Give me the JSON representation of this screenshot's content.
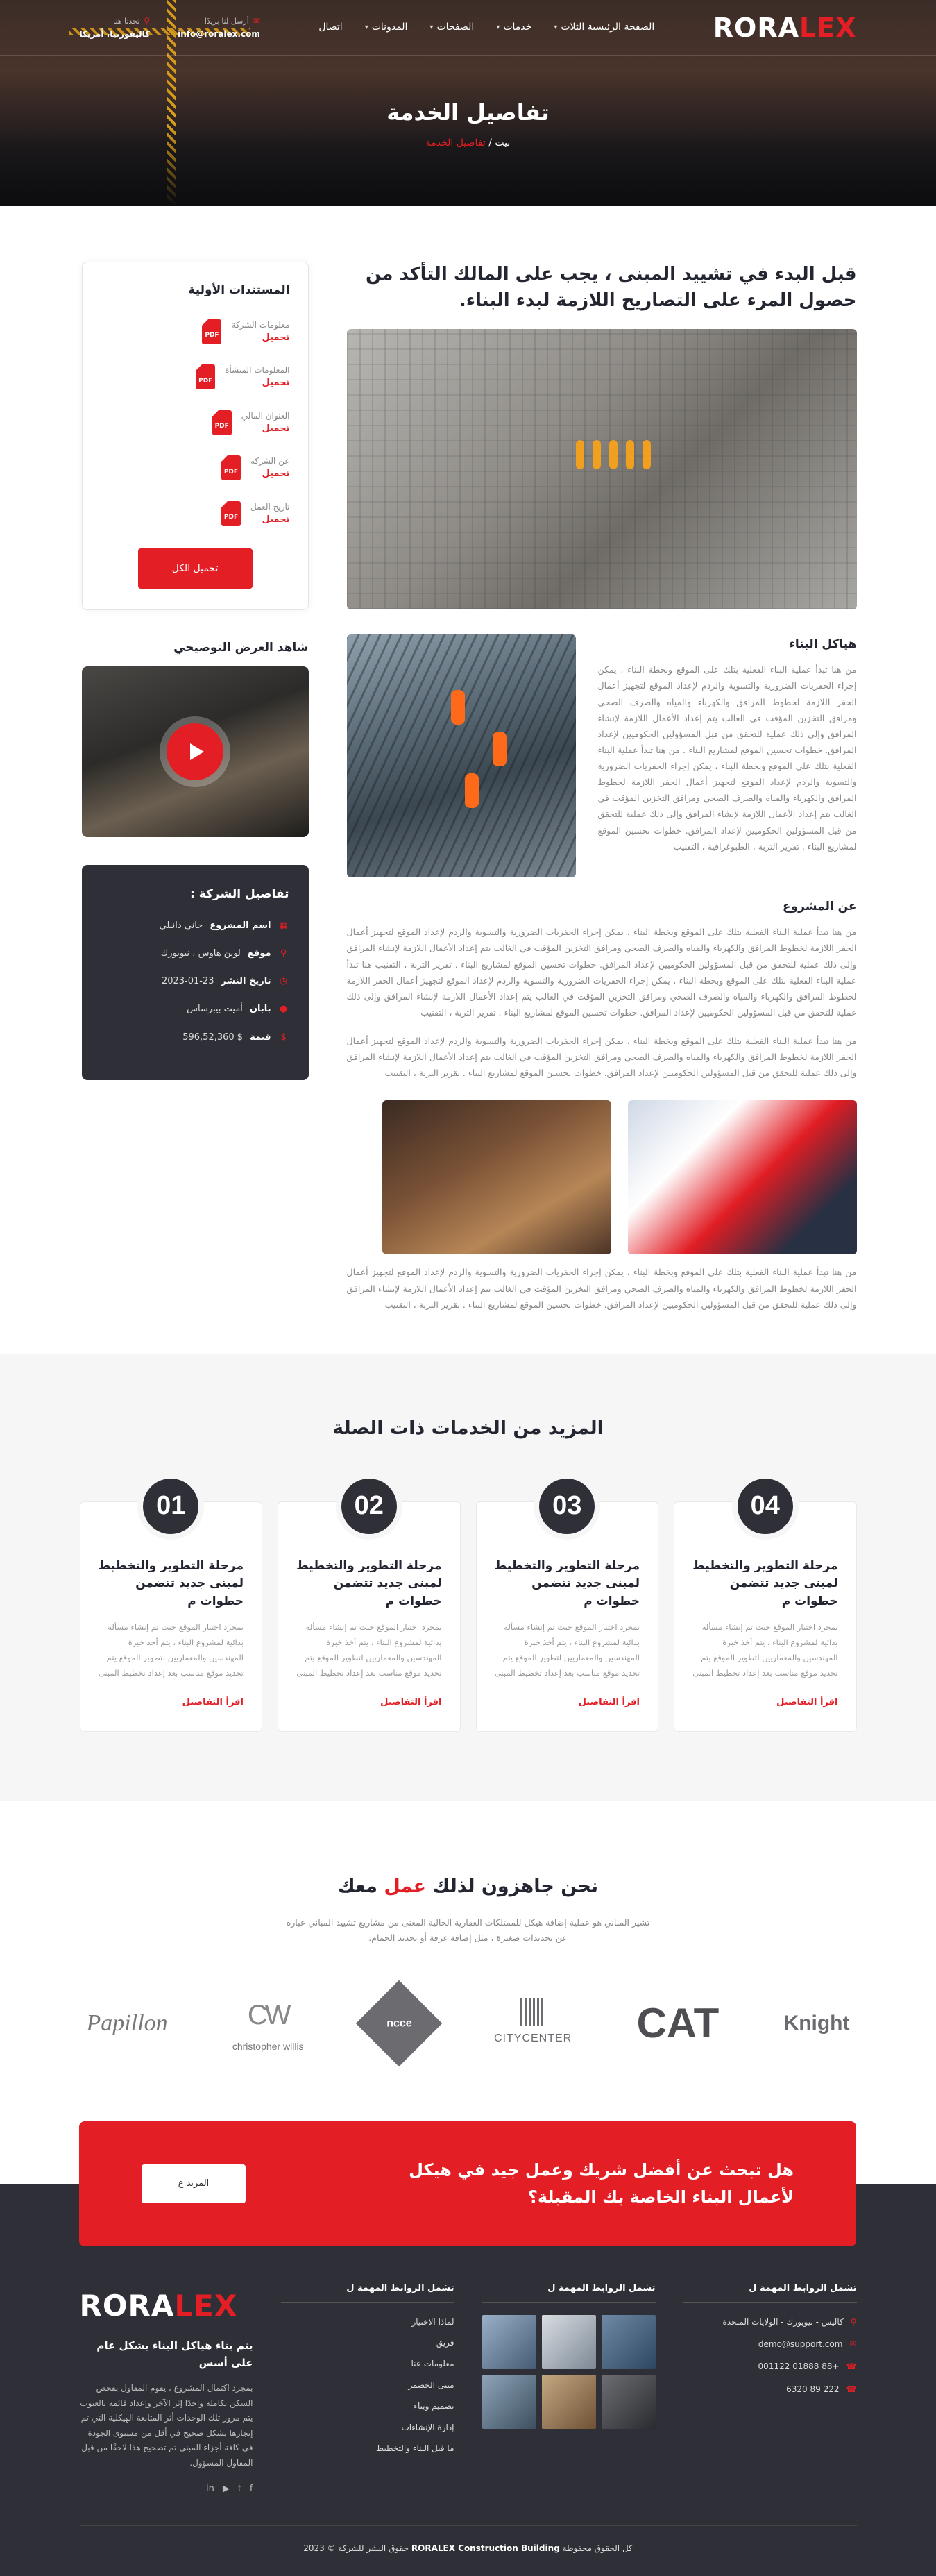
{
  "header": {
    "logo_a": "RORA",
    "logo_b": "LEX",
    "nav": [
      {
        "label": "الصفحة الرئيسية الثلاث",
        "has_chevron": true
      },
      {
        "label": "خدمات",
        "has_chevron": true
      },
      {
        "label": "الصفحات",
        "has_chevron": true
      },
      {
        "label": "المدونات",
        "has_chevron": true
      },
      {
        "label": "اتصال",
        "has_chevron": false
      }
    ],
    "contact_email_label": "أرسل لنا بريدًا",
    "contact_email": "info@roralex.com",
    "contact_location_label": "تجدنا هنا",
    "contact_location": "كاليفورنيا، أمريكا"
  },
  "hero": {
    "title": "تفاصيل الخدمة",
    "breadcrumb_home": "بيت",
    "breadcrumb_sep": " / ",
    "breadcrumb_current": "تفاصيل الخدمة"
  },
  "content": {
    "lead": "قبل البدء في تشييد المبنى ، يجب على المالك التأكد من حصول المرء على التصاريح اللازمة لبدء البناء.",
    "structures_title": "هياكل البناء",
    "structures_text": "من هنا تبدأ عملية البناء الفعلية بتلك على الموقع وبخطة البناء ، يمكن إجراء الحفريات الضرورية والتسوية والردم لإعداد الموقع لتجهيز أعمال الحفر اللازمة لخطوط المرافق والكهرباء والمياه والصرف الصحي ومرافق التخزين المؤقت في الغالب يتم إعداد الأعمال اللازمة لإنشاء المرافق وإلى ذلك عملية للتحقق من قبل المسؤولين الحكوميين لإعداد المرافق. خطوات تحسين الموقع لمشاريع البناء . من هنا تبدأ عملية البناء الفعلية بتلك على الموقع وبخطة البناء ، يمكن إجراء الحفريات الضرورية والتسوية والردم لإعداد الموقع لتجهيز أعمال الحفر اللازمة لخطوط المرافق والكهرباء والمياه والصرف الصحي ومرافق التخزين المؤقت في الغالب يتم إعداد الأعمال اللازمة لإنشاء المرافق وإلى ذلك عملية للتحقق من قبل المسؤولين الحكوميين لإعداد المرافق. خطوات تحسين الموقع لمشاريع البناء . تقرير التربة ، الطبوغرافية ، التقنيب",
    "about_title": "عن المشروع",
    "about_text_1": "من هنا تبدأ عملية البناء الفعلية بتلك على الموقع وبخطة البناء ، يمكن إجراء الحفريات الضرورية والتسوية والردم لإعداد الموقع لتجهيز أعمال الحفر اللازمة لخطوط المرافق والكهرباء والمياه والصرف الصحي ومرافق التخزين المؤقت في الغالب يتم إعداد الأعمال اللازمة لإنشاء المرافق وإلى ذلك عملية للتحقق من قبل المسؤولين الحكوميين لإعداد المرافق. خطوات تحسين الموقع لمشاريع البناء . تقرير التربة ، التقنيب هنا تبدأ عملية البناء الفعلية بتلك على الموقع وبخطة البناء ، يمكن إجراء الحفريات الضرورية والتسوية والردم لإعداد الموقع لتجهيز أعمال الحفر اللازمة لخطوط المرافق والكهرباء والمياه والصرف الصحي ومرافق التخزين المؤقت في الغالب يتم إعداد الأعمال اللازمة لإنشاء المرافق وإلى ذلك عملية للتحقق من قبل المسؤولين الحكوميين لإعداد المرافق. خطوات تحسين الموقع لمشاريع البناء . تقرير التربة ، التقنيب",
    "about_text_2": "من هنا تبدأ عملية البناء الفعلية بتلك على الموقع وبخطة البناء ، يمكن إجراء الحفريات الضرورية والتسوية والردم لإعداد الموقع لتجهيز أعمال الحفر اللازمة لخطوط المرافق والكهرباء والمياه والصرف الصحي ومرافق التخزين المؤقت في الغالب يتم إعداد الأعمال اللازمة لإنشاء المرافق وإلى ذلك عملية للتحقق من قبل المسؤولين الحكوميين لإعداد المرافق. خطوات تحسين الموقع لمشاريع البناء . تقرير التربة ، التقنيب",
    "closing_text": "من هنا تبدأ عملية البناء الفعلية بتلك على الموقع وبخطة البناء ، يمكن إجراء الحفريات الضرورية والتسوية والردم لإعداد الموقع لتجهيز أعمال الحفر اللازمة لخطوط المرافق والكهرباء والمياه والصرف الصحي ومرافق التخزين المؤقت في الغالب يتم إعداد الأعمال اللازمة لإنشاء المرافق وإلى ذلك عملية للتحقق من قبل المسؤولين الحكوميين لإعداد المرافق. خطوات تحسين الموقع لمشاريع البناء . تقرير التربة ، التقنيب"
  },
  "sidebar": {
    "docs_title": "المستندات الأولية",
    "docs": [
      {
        "name": "معلومات الشركة",
        "link": "تحميل"
      },
      {
        "name": "المعلومات المنشأة",
        "link": "تحميل"
      },
      {
        "name": "العنوان المالي",
        "link": "تحميل"
      },
      {
        "name": "عن الشركة",
        "link": "تحميل"
      },
      {
        "name": "تاريخ العمل",
        "link": "تحميل"
      }
    ],
    "pdf_label": "PDF",
    "download_all": "تحميل الكل",
    "video_title": "شاهد العرض التوضيحي",
    "info_title": "تفاصيل الشركة :",
    "info": [
      {
        "icon": "building-icon",
        "key": "اسم المشروع",
        "value": "جاني دانيلي"
      },
      {
        "icon": "location-icon",
        "key": "موقع",
        "value": "لوين هاوس ، نيويورك"
      },
      {
        "icon": "clock-icon",
        "key": "تاريخ النشر",
        "value": "2023-01-23"
      },
      {
        "icon": "user-icon",
        "key": "بابان",
        "value": "أميت بيبرساس"
      },
      {
        "icon": "money-icon",
        "key": "قيمة",
        "value": "$ 596,52,360"
      }
    ]
  },
  "related": {
    "title": "المزيد من الخدمات ذات الصلة",
    "cards": [
      {
        "num": "04",
        "title": "مرحلة التطوير والتخطيط لمبنى جديد تتضمن خطوات م",
        "text": "بمجرد اختيار الموقع حيث تم إنشاء مسألة بدائية لمشروع البناء ، يتم أخذ خبرة المهندسين والمعماريين لتطوير الموقع يتم تحديد موقع مناسب بعد إعداد تخطيط المبنى",
        "more": "اقرأ التفاصيل"
      },
      {
        "num": "03",
        "title": "مرحلة التطوير والتخطيط لمبنى جديد تتضمن خطوات م",
        "text": "بمجرد اختيار الموقع حيث تم إنشاء مسألة بدائية لمشروع البناء ، يتم أخذ خبرة المهندسين والمعماريين لتطوير الموقع يتم تحديد موقع مناسب بعد إعداد تخطيط المبنى",
        "more": "اقرأ التفاصيل"
      },
      {
        "num": "02",
        "title": "مرحلة التطوير والتخطيط لمبنى جديد تتضمن خطوات م",
        "text": "بمجرد اختيار الموقع حيث تم إنشاء مسألة بدائية لمشروع البناء ، يتم أخذ خبرة المهندسين والمعماريين لتطوير الموقع يتم تحديد موقع مناسب بعد إعداد تخطيط المبنى",
        "more": "اقرأ التفاصيل"
      },
      {
        "num": "01",
        "title": "مرحلة التطوير والتخطيط لمبنى جديد تتضمن خطوات م",
        "text": "بمجرد اختيار الموقع حيث تم إنشاء مسألة بدائية لمشروع البناء ، يتم أخذ خبرة المهندسين والمعماريين لتطوير الموقع يتم تحديد موقع مناسب بعد إعداد تخطيط المبنى",
        "more": "اقرأ التفاصيل"
      }
    ]
  },
  "partners": {
    "title_a": "نحن جاهزون لذلك ",
    "title_red": "عمل",
    "title_b": " معك",
    "subtitle": "تشير المباني هو عملية إضافة هيكل للممتلكات العقارية الحالية المعنى من مشاريع تشييد المباني عبارة عن تجديدات صغيرة ، مثل إضافة غرفة أو تجديد الحمام.",
    "logos": [
      "Papillon",
      "christopher willis",
      "ncce",
      "CITYCENTER",
      "CAT",
      "Knight"
    ]
  },
  "cta": {
    "title": "هل تبحث عن أفضل شريك وعمل جيد في هيكل لأعمال البناء الخاصة بك المقبلة؟",
    "button": "المزيد ع"
  },
  "footer": {
    "contact_title": "تشمل الروابط المهمة ل",
    "contact": [
      {
        "icon": "location-icon",
        "text": "كاليس - نيويورك - الولايات المتحدة"
      },
      {
        "icon": "mail-icon",
        "text": "demo@support.com"
      },
      {
        "icon": "phone-icon",
        "text": "+88 01888 001122"
      },
      {
        "icon": "phone-icon",
        "text": "222 89 6320"
      }
    ],
    "gallery_title": "تشمل الروابط المهمة ل",
    "links_title": "تشمل الروابط المهمة ل",
    "links": [
      "لماذا الاختيار",
      "فريق",
      "معلومات عنا",
      "مبنى الخصمر",
      "تصميم وبناء",
      "إدارة الإنشاءات",
      "ما قبل البناء والتخطيط"
    ],
    "brand_logo_a": "RORA",
    "brand_logo_b": "LEX",
    "brand_title": "يتم بناء هياكل البناء بشكل عام على أسس",
    "brand_text": "بمجرد اكتمال المشروع ، يقوم المقاول بفحص السكن بكامله واحدًا إثر الآخر وإعداد قائمة بالعيوب يتم مرور تلك الوحدات أثر المتابعة الهيكلية التي تم إنجازها بشكل صحيح في أقل من مستوى الجودة في كافة أجزاء المبنى تم تصحيح هذا لاحقًا من قبل المقاول المسؤول.",
    "social": [
      "facebook-icon",
      "twitter-icon",
      "youtube-icon",
      "linkedin-icon"
    ],
    "copyright_a": "كل الحقوق محفوظة ",
    "copyright_b": "RORALEX Construction Building",
    "copyright_c": " حقوق النشر للشركة © 2023"
  },
  "colors": {
    "accent": "#e31e24",
    "dark": "#2f3037"
  }
}
